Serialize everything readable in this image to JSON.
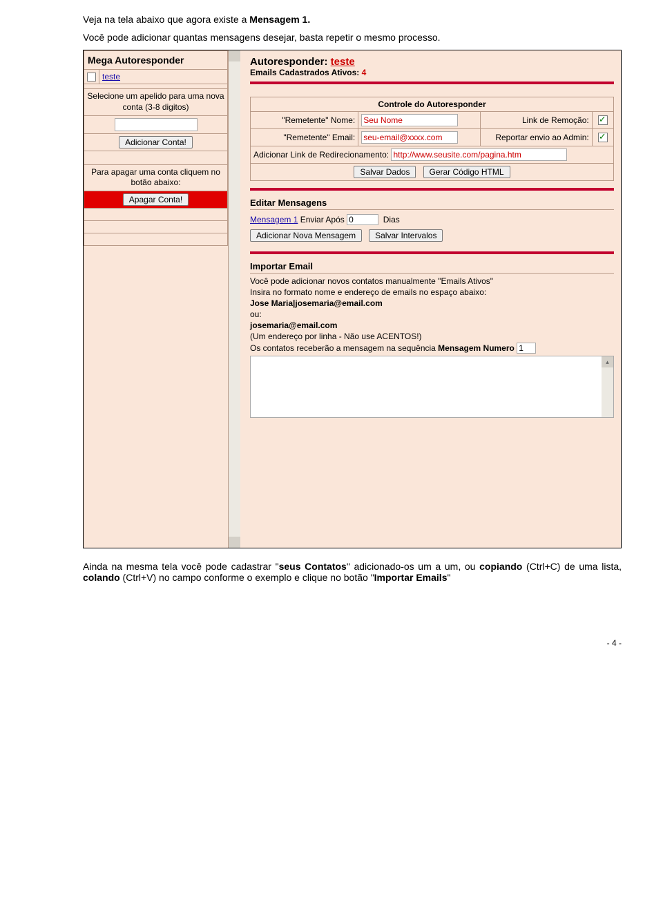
{
  "doc": {
    "line1a": "Veja na tela abaixo que agora existe a ",
    "line1b": "Mensagem 1.",
    "line2": "Você pode adicionar quantas mensagens desejar, basta repetir o mesmo processo.",
    "after1a": "Ainda na mesma tela você pode cadastrar \"",
    "after1b": "seus Contatos",
    "after1c": "\" adicionado-os um a um, ou ",
    "after1d": "copiando",
    "after1e": " (Ctrl+C) de uma lista, ",
    "after1f": "colando",
    "after1g": " (Ctrl+V) no campo conforme o exemplo e clique no botão \"",
    "after1h": "Importar Emails",
    "after1i": "\"",
    "page": "- 4 -"
  },
  "sidebar": {
    "title": "Mega Autoresponder",
    "item": "teste",
    "help_text": "Selecione um apelido para uma nova conta (3-8 digitos)",
    "add_btn": "Adicionar Conta!",
    "del_help": "Para apagar uma conta cliquem no botão abaixo:",
    "del_btn": "Apagar Conta!"
  },
  "main": {
    "title_a": "Autoresponder: ",
    "title_b": "teste",
    "emails_a": "Emails Cadastrados Ativos: ",
    "emails_n": "4",
    "ctrl_header": "Controle do Autoresponder",
    "rnome_lbl": "\"Remetente\" Nome:",
    "rnome_val": "Seu Nome",
    "link_rem": "Link de Remoção:",
    "remail_lbl": "\"Remetente\" Email:",
    "remail_val": "seu-email@xxxx.com",
    "report_lbl": "Reportar envio ao Admin:",
    "redir_lbl": "Adicionar Link de Redirecionamento:",
    "redir_val": "http://www.seusite.com/pagina.htm",
    "save_btn": "Salvar Dados",
    "gen_btn": "Gerar Código HTML",
    "edit_head": "Editar Mensagens",
    "msg1_link": "Mensagem 1",
    "msg1_txt": " Enviar Após ",
    "msg1_val": "0",
    "msg1_dias": "Dias",
    "addmsg_btn": "Adicionar Nova Mensagem",
    "saveint_btn": "Salvar Intervalos",
    "imp_head": "Importar Email",
    "imp_l1": "Você pode adicionar novos contatos manualmente \"Emails Ativos\"",
    "imp_l2": "Insira no formato nome e endereço de emails no espaço abaixo:",
    "imp_l3": "Jose Maria|josemaria@email.com",
    "imp_l4": "ou:",
    "imp_l5": "josemaria@email.com",
    "imp_l6": "(Um endereço por linha - Não use ACENTOS!)",
    "imp_l7a": "Os contatos receberão a mensagem na sequência ",
    "imp_l7b": "Mensagem Numero",
    "imp_num": "1"
  }
}
